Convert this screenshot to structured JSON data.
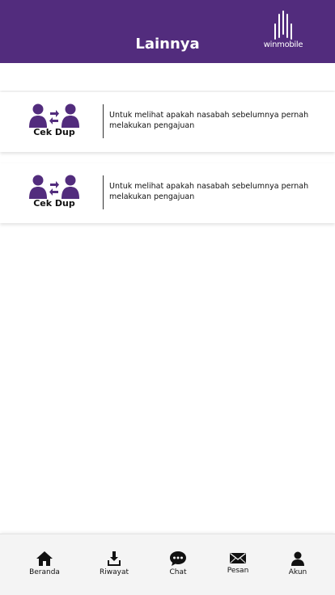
{
  "header": {
    "title": "Lainnya",
    "logo_text": "winmobile",
    "background": "#522c7d"
  },
  "cards": [
    {
      "label": "Cek Dup",
      "description": "Untuk melihat apakah nasabah sebelumnya pernah melakukan pengajuan",
      "icon": "user-exchange-icon"
    },
    {
      "label": "Cek Dup",
      "description": "Untuk melihat apakah nasabah sebelumnya pernah melakukan pengajuan",
      "icon": "user-exchange-icon"
    }
  ],
  "bottom_nav": {
    "items": [
      {
        "label": "Beranda",
        "icon": "home-icon"
      },
      {
        "label": "Riwayat",
        "icon": "download-icon"
      },
      {
        "label": "Chat",
        "icon": "chat-icon"
      },
      {
        "label": "Pesan",
        "icon": "envelope-icon"
      },
      {
        "label": "Akun",
        "icon": "user-icon"
      }
    ]
  },
  "colors": {
    "accent": "#522c7d",
    "nav_icon": "#111111"
  }
}
